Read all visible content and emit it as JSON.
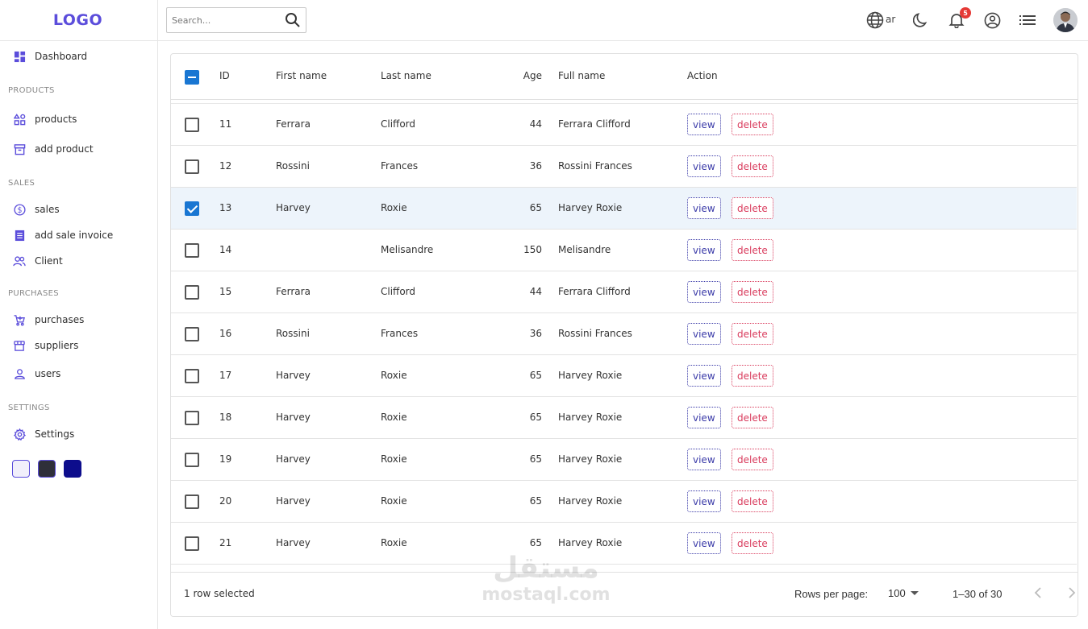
{
  "brand": {
    "logo": "LOGO",
    "accent": "#5b4ddb"
  },
  "sidebar": {
    "dashboard": {
      "label": "Dashboard",
      "icon": "dashboard-icon"
    },
    "sections": [
      {
        "title": "PRODUCTS",
        "items": [
          {
            "label": "products",
            "icon": "category-icon"
          },
          {
            "label": "add product",
            "icon": "archive-icon"
          }
        ]
      },
      {
        "title": "SALES",
        "items": [
          {
            "label": "sales",
            "icon": "dollar-circle-icon"
          },
          {
            "label": "add sale invoice",
            "icon": "receipt-icon"
          },
          {
            "label": "Client",
            "icon": "people-icon"
          }
        ]
      },
      {
        "title": "PURCHASES",
        "items": [
          {
            "label": "purchases",
            "icon": "cart-icon"
          },
          {
            "label": "suppliers",
            "icon": "store-icon"
          },
          {
            "label": "users",
            "icon": "person-icon"
          }
        ]
      },
      {
        "title": "SETTINGS",
        "items": [
          {
            "label": "Settings",
            "icon": "gear-icon"
          }
        ]
      }
    ],
    "theme_swatches": [
      "#f1effb",
      "#2f2f3a",
      "#0d0d8c"
    ]
  },
  "header": {
    "search_placeholder": "Search...",
    "language": "ar",
    "notification_count": "5"
  },
  "table": {
    "columns": {
      "id": "ID",
      "first": "First name",
      "last": "Last name",
      "age": "Age",
      "full": "Full name",
      "action": "Action"
    },
    "view_label": "view",
    "delete_label": "delete",
    "rows": [
      {
        "id": "11",
        "first": "Ferrara",
        "last": "Clifford",
        "age": "44",
        "full": "Ferrara Clifford",
        "selected": false
      },
      {
        "id": "12",
        "first": "Rossini",
        "last": "Frances",
        "age": "36",
        "full": "Rossini Frances",
        "selected": false
      },
      {
        "id": "13",
        "first": "Harvey",
        "last": "Roxie",
        "age": "65",
        "full": "Harvey Roxie",
        "selected": true
      },
      {
        "id": "14",
        "first": "",
        "last": "Melisandre",
        "age": "150",
        "full": "Melisandre",
        "selected": false
      },
      {
        "id": "15",
        "first": "Ferrara",
        "last": "Clifford",
        "age": "44",
        "full": "Ferrara Clifford",
        "selected": false
      },
      {
        "id": "16",
        "first": "Rossini",
        "last": "Frances",
        "age": "36",
        "full": "Rossini Frances",
        "selected": false
      },
      {
        "id": "17",
        "first": "Harvey",
        "last": "Roxie",
        "age": "65",
        "full": "Harvey Roxie",
        "selected": false
      },
      {
        "id": "18",
        "first": "Harvey",
        "last": "Roxie",
        "age": "65",
        "full": "Harvey Roxie",
        "selected": false
      },
      {
        "id": "19",
        "first": "Harvey",
        "last": "Roxie",
        "age": "65",
        "full": "Harvey Roxie",
        "selected": false
      },
      {
        "id": "20",
        "first": "Harvey",
        "last": "Roxie",
        "age": "65",
        "full": "Harvey Roxie",
        "selected": false
      },
      {
        "id": "21",
        "first": "Harvey",
        "last": "Roxie",
        "age": "65",
        "full": "Harvey Roxie",
        "selected": false
      }
    ],
    "footer": {
      "selected_text": "1 row selected",
      "rows_per_page_label": "Rows per page:",
      "rows_per_page_value": "100",
      "range_text": "1–30 of 30"
    }
  },
  "watermark": {
    "arabic": "مستقل",
    "latin": "mostaql.com"
  }
}
